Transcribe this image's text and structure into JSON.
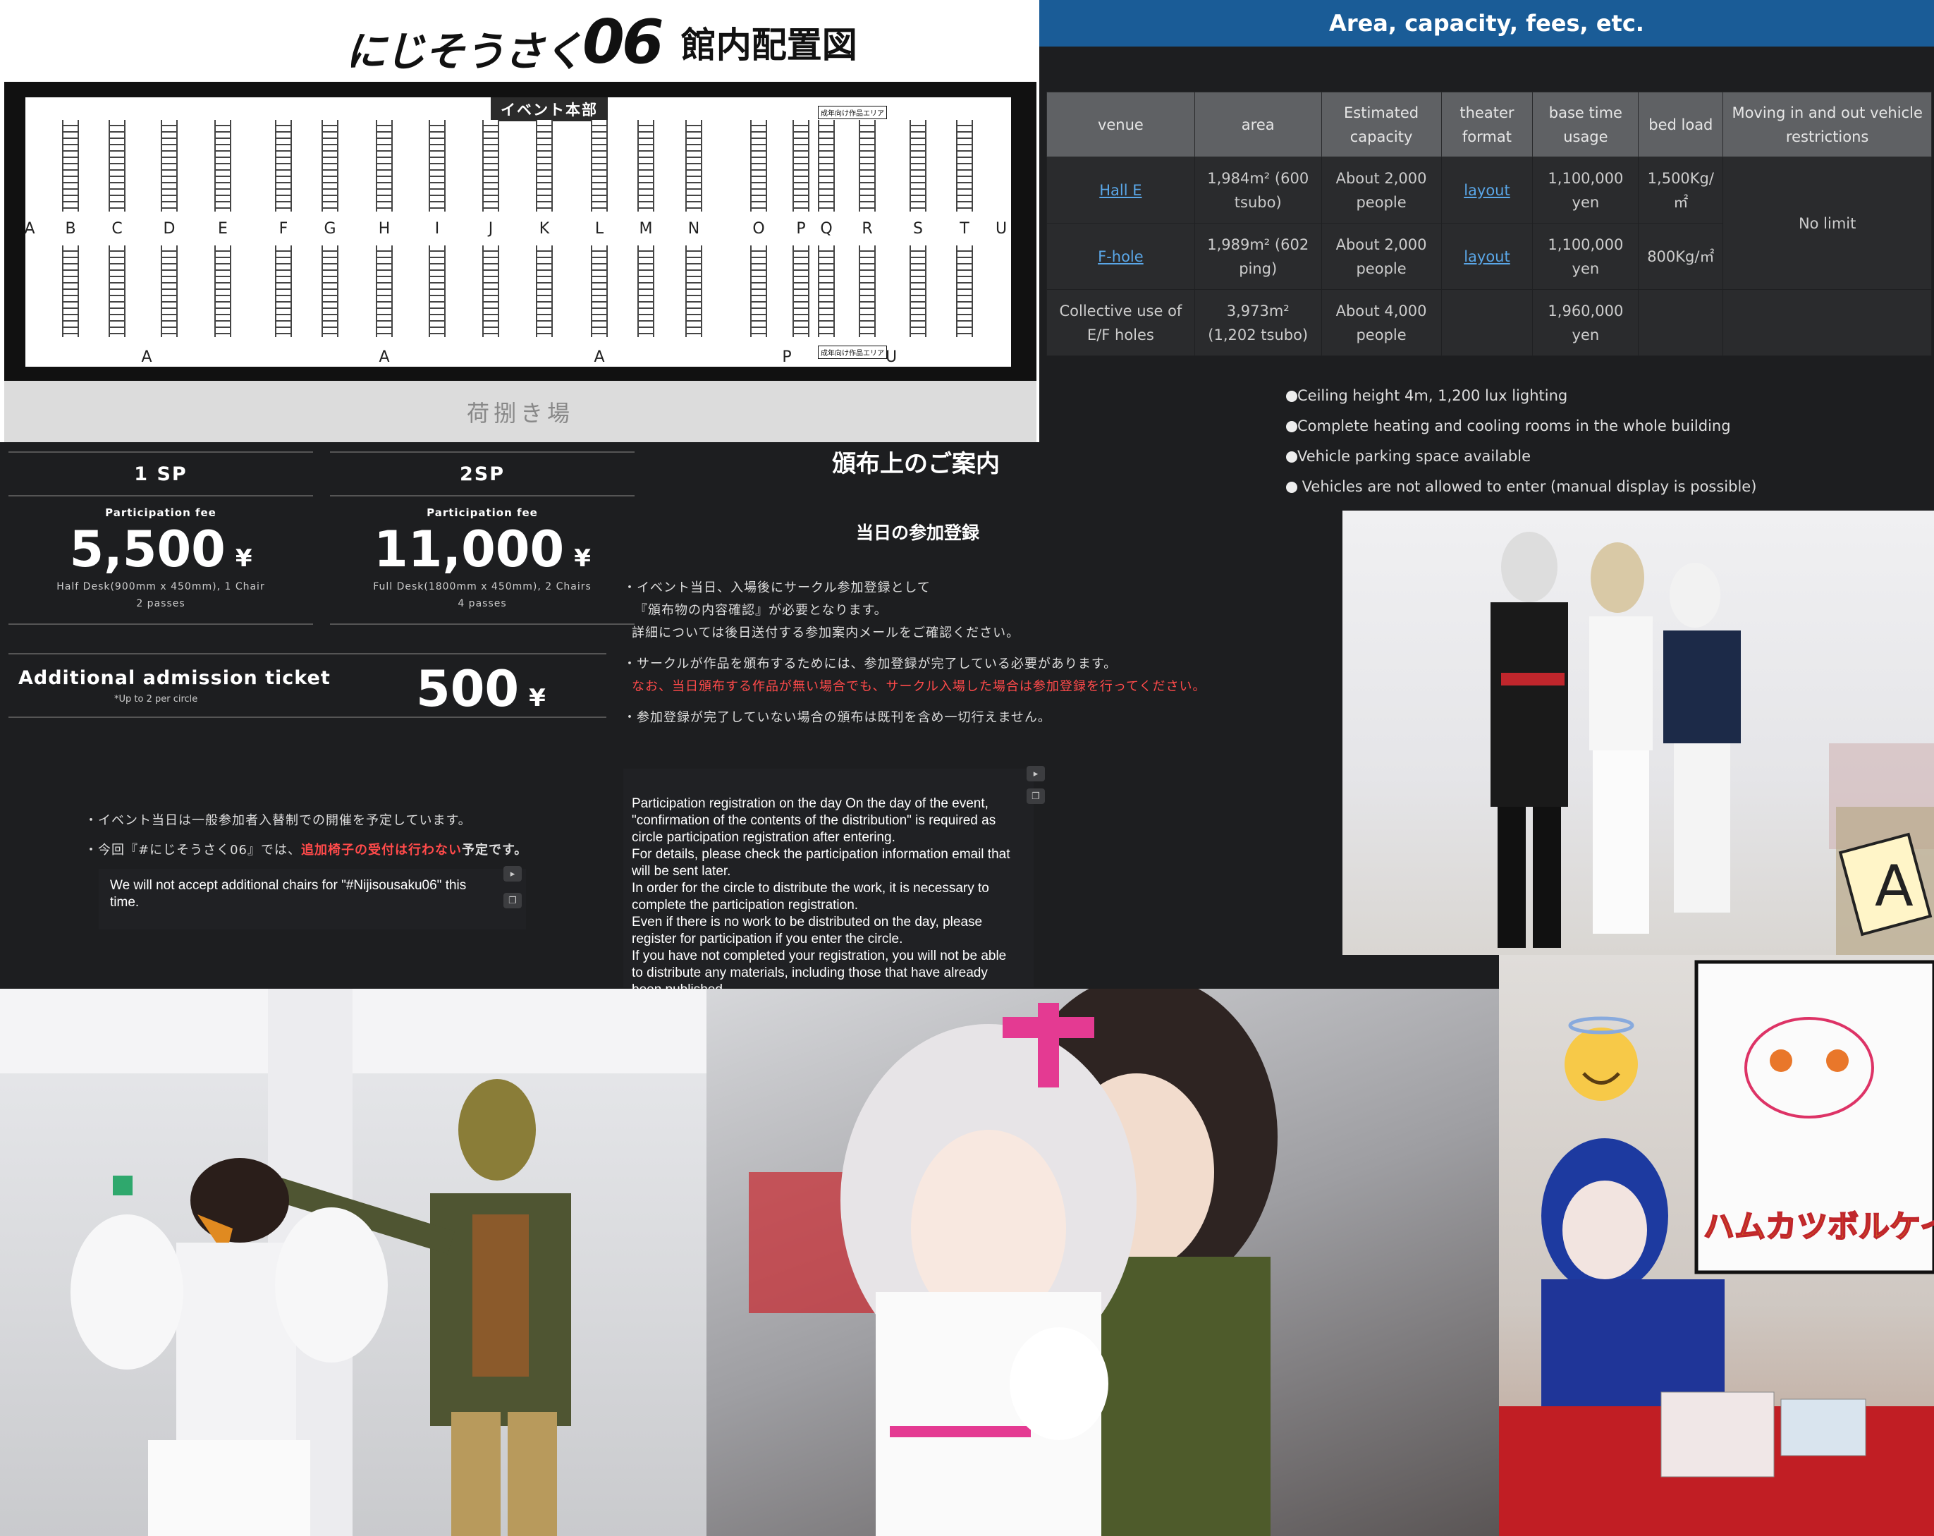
{
  "map": {
    "logo_word": "にじそうさく",
    "logo_num": "06",
    "title": "館内配置図",
    "hq_label": "イベント本部",
    "adult_area": "成年向け作品エリア",
    "unloading": "荷捌き場",
    "columns": [
      "A",
      "B",
      "C",
      "D",
      "E",
      "F",
      "G",
      "H",
      "I",
      "J",
      "K",
      "L",
      "M",
      "N",
      "O",
      "P",
      "Q",
      "R",
      "S",
      "T",
      "U"
    ],
    "bottom_labels": [
      "A",
      "A",
      "A",
      "P",
      "U"
    ]
  },
  "area": {
    "header": "Area, capacity, fees, etc.",
    "columns": [
      "venue",
      "area",
      "Estimated capacity",
      "theater format",
      "base time usage",
      "bed load",
      "Moving in and out vehicle restrictions"
    ],
    "rows": [
      {
        "venue": "Hall E",
        "area": "1,984m² (600 tsubo)",
        "capacity": "About 2,000 people",
        "format": "layout",
        "fee": "1,100,000 yen",
        "load": "1,500Kg/㎡"
      },
      {
        "venue": "F-hole",
        "area": "1,989m² (602 ping)",
        "capacity": "About 2,000 people",
        "format": "layout",
        "fee": "1,100,000 yen",
        "load": "800Kg/㎡"
      },
      {
        "venue": "Collective use of E/F holes",
        "area": "3,973m² (1,202 tsubo)",
        "capacity": "About 4,000 people",
        "format": "",
        "fee": "1,960,000 yen",
        "load": ""
      }
    ],
    "restriction": "No limit",
    "bullets": [
      "Ceiling height 4m, 1,200 lux lighting",
      "Complete heating and cooling rooms in the whole building",
      "Vehicle parking space available",
      " Vehicles are not allowed to enter (manual display is possible)"
    ]
  },
  "pricing": {
    "plans": [
      {
        "name": "1 SP",
        "label": "Participation fee",
        "price": "5,500",
        "yen": "¥",
        "desc": "Half Desk(900mm x 450mm), 1 Chair",
        "passes": "2 passes"
      },
      {
        "name": "2SP",
        "label": "Participation fee",
        "price": "11,000",
        "yen": "¥",
        "desc": "Full Desk(1800mm x 450mm), 2 Chairs",
        "passes": "4 passes"
      }
    ],
    "additional": {
      "name": "Additional admission ticket",
      "note": "*Up to 2 per circle",
      "price": "500",
      "yen": "¥"
    }
  },
  "notes": {
    "line1": "・イベント当日は一般参加者入替制での開催を予定しています。",
    "line2_a": "・今回『#にじそうさく06』では、",
    "line2_red": "追加椅子の受付は行わない",
    "line2_b": "予定です。",
    "translation": "We will not accept additional chairs for \"#Nijisousaku06\" this time."
  },
  "guide": {
    "title": "頒布上のご案内",
    "subtitle": "当日の参加登録",
    "l1": "・イベント当日、入場後にサークル参加登録として",
    "l2": "『頒布物の内容確認』が必要となります。",
    "l3": "詳細については後日送付する参加案内メールをご確認ください。",
    "l4": "・サークルが作品を頒布するためには、参加登録が完了している必要があります。",
    "l5": "なお、当日頒布する作品が無い場合でも、サークル入場した場合は参加登録を行ってください。",
    "l6": "・参加登録が完了していない場合の頒布は既刊を含め一切行えません。",
    "translation": "Participation registration on the day On the day of the event, \"confirmation of the contents of the distribution\" is required as circle participation registration after entering.\n      For details, please check the participation information email that will be sent later.\n      In order for the circle to distribute the work, it is necessary to complete the participation registration.\n      Even if there is no work to be distributed on the day, please register for participation if you enter the circle.\n      If you have not completed your registration, you will not be able to distribute any materials, including those that have already been published."
  },
  "photos": {
    "sign_text": "ハムカツボルケイノ",
    "booth_letter": "A"
  },
  "colors": {
    "accent_blue": "#1a5c97",
    "link": "#5aa7e8",
    "warn_red": "#ff4a4a",
    "dark_bg": "#1d1e20"
  }
}
